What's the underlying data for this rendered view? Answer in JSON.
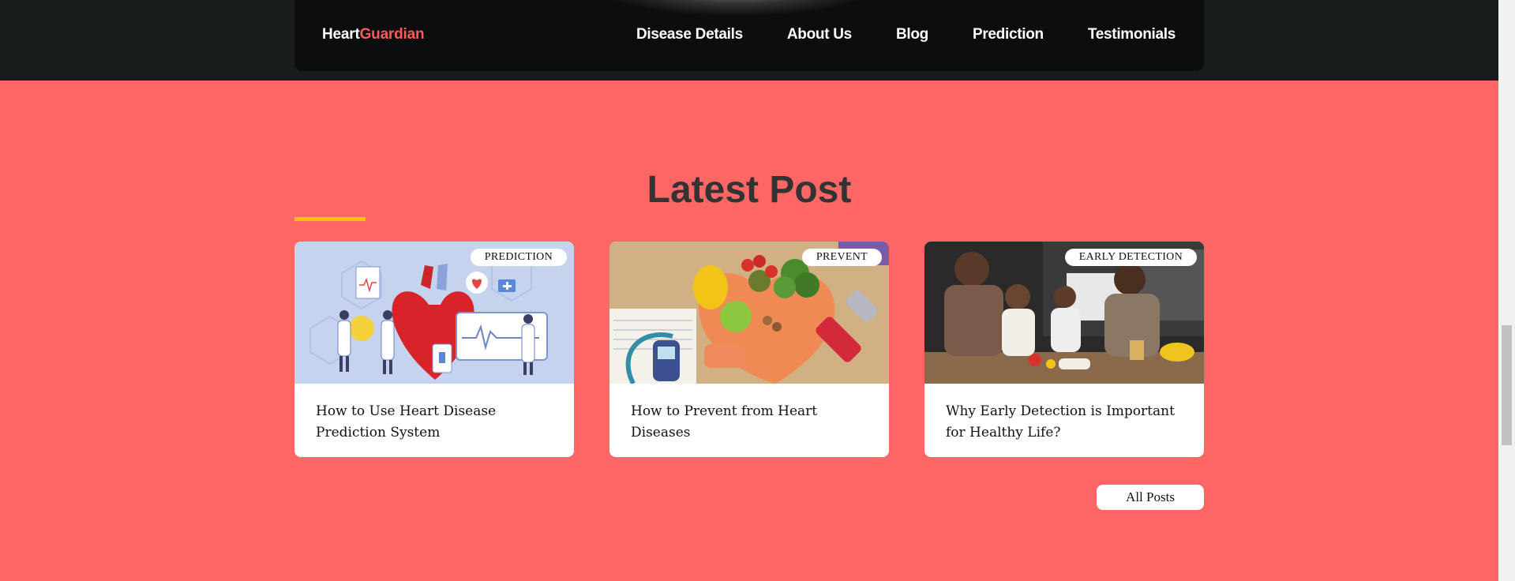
{
  "nav": {
    "logo_part1": "Heart",
    "logo_part2": "Guardian",
    "links": [
      "Disease Details",
      "About Us",
      "Blog",
      "Prediction",
      "Testimonials"
    ]
  },
  "section": {
    "title": "Latest Post"
  },
  "posts": [
    {
      "badge": "PREDICTION",
      "title": "How to Use Heart Disease Prediction System"
    },
    {
      "badge": "PREVENT",
      "title": "How to Prevent from Heart Diseases"
    },
    {
      "badge": "EARLY DETECTION",
      "title": "Why Early Detection is Important for Healthy Life?"
    }
  ],
  "all_posts_label": "All Posts",
  "colors": {
    "accent": "#ff6666",
    "logo_accent": "#ff5a5a",
    "underline": "#ffc107",
    "nav_bg": "#0b0d0e"
  }
}
